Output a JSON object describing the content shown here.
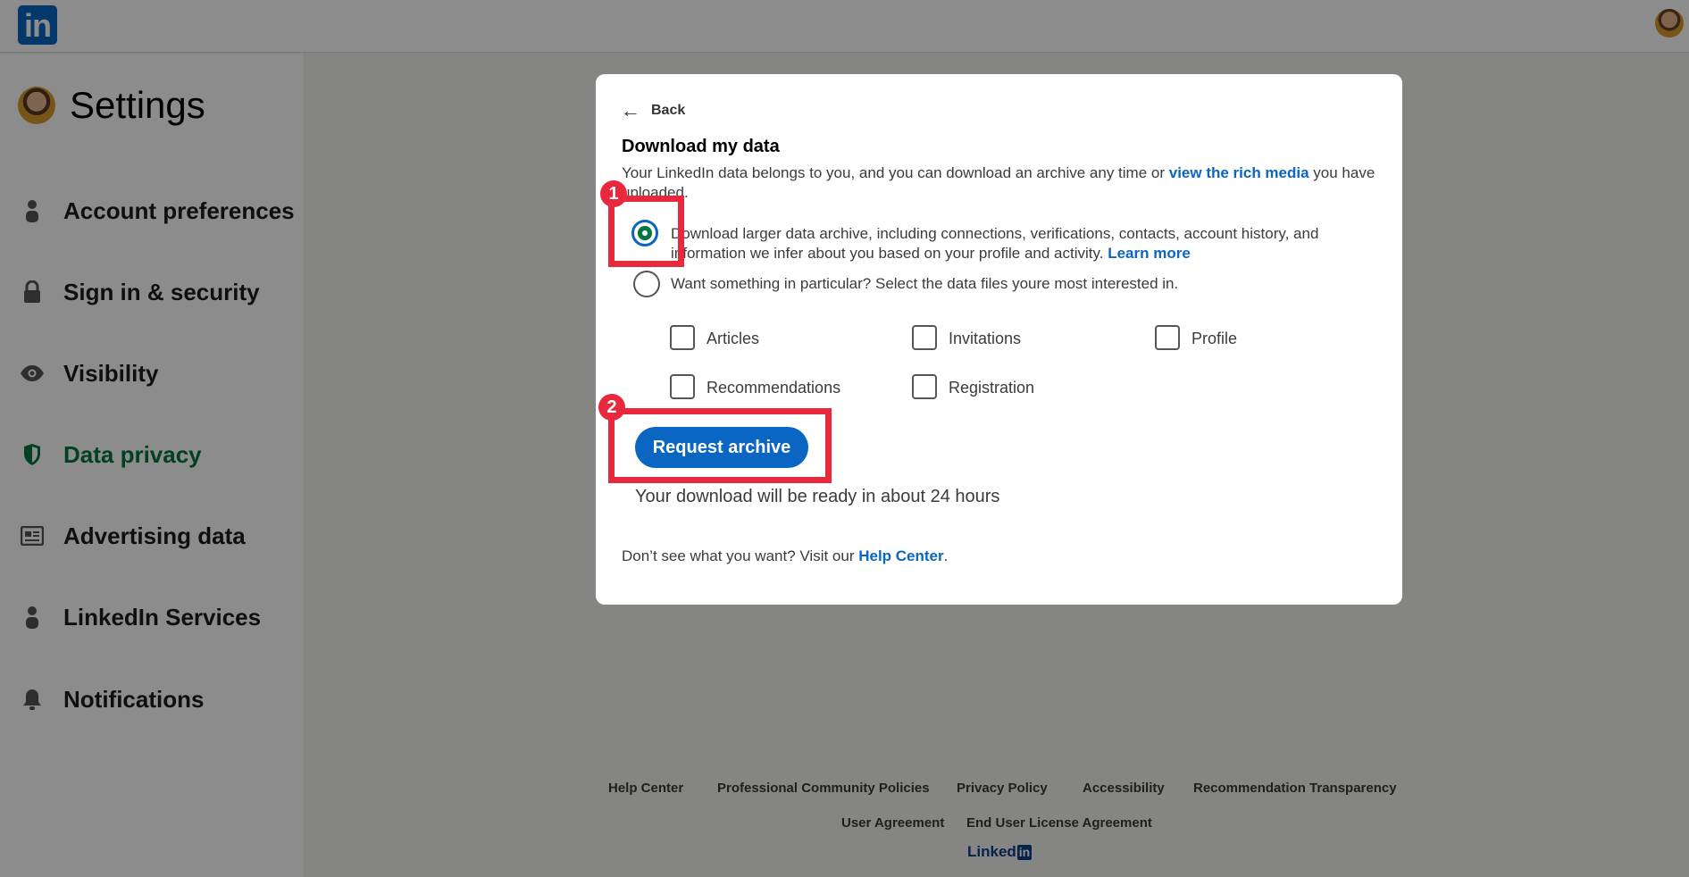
{
  "app": {
    "logo_text": "in",
    "brand_color": "#0a66c2",
    "active_color": "#057642",
    "annotation_color": "#e8283c"
  },
  "sidebar": {
    "title": "Settings",
    "items": [
      {
        "label": "Account preferences",
        "icon": "person-icon"
      },
      {
        "label": "Sign in & security",
        "icon": "lock-icon"
      },
      {
        "label": "Visibility",
        "icon": "eye-icon"
      },
      {
        "label": "Data privacy",
        "icon": "shield-icon",
        "active": true
      },
      {
        "label": "Advertising data",
        "icon": "newspaper-icon"
      },
      {
        "label": "LinkedIn Services",
        "icon": "person-icon"
      },
      {
        "label": "Notifications",
        "icon": "bell-icon"
      }
    ]
  },
  "modal": {
    "back_label": "Back",
    "title": "Download my data",
    "description_prefix": "Your LinkedIn data belongs to you, and you can download an archive any time or ",
    "description_link": "view the rich media",
    "description_suffix": " you have uploaded.",
    "option_full_text": "Download larger data archive, including connections, verifications, contacts, account history, and information we infer about you based on your profile and activity. ",
    "option_full_link": "Learn more",
    "option_partial_text": "Want something in particular? Select the data files youre most interested in.",
    "checkboxes": [
      "Articles",
      "Invitations",
      "Profile",
      "Recommendations",
      "Registration"
    ],
    "request_button": "Request archive",
    "ready_text": "Your download will be ready in about 24 hours",
    "help_prefix": "Don’t see what you want? Visit our ",
    "help_link": "Help Center",
    "help_suffix": "."
  },
  "annotations": {
    "badge_1": "1",
    "badge_2": "2"
  },
  "footer": {
    "links": [
      "Help Center",
      "Professional Community Policies",
      "Privacy Policy",
      "Accessibility",
      "Recommendation Transparency",
      "User Agreement",
      "End User License Agreement"
    ],
    "brand_text": "Linked",
    "brand_box": "in"
  }
}
